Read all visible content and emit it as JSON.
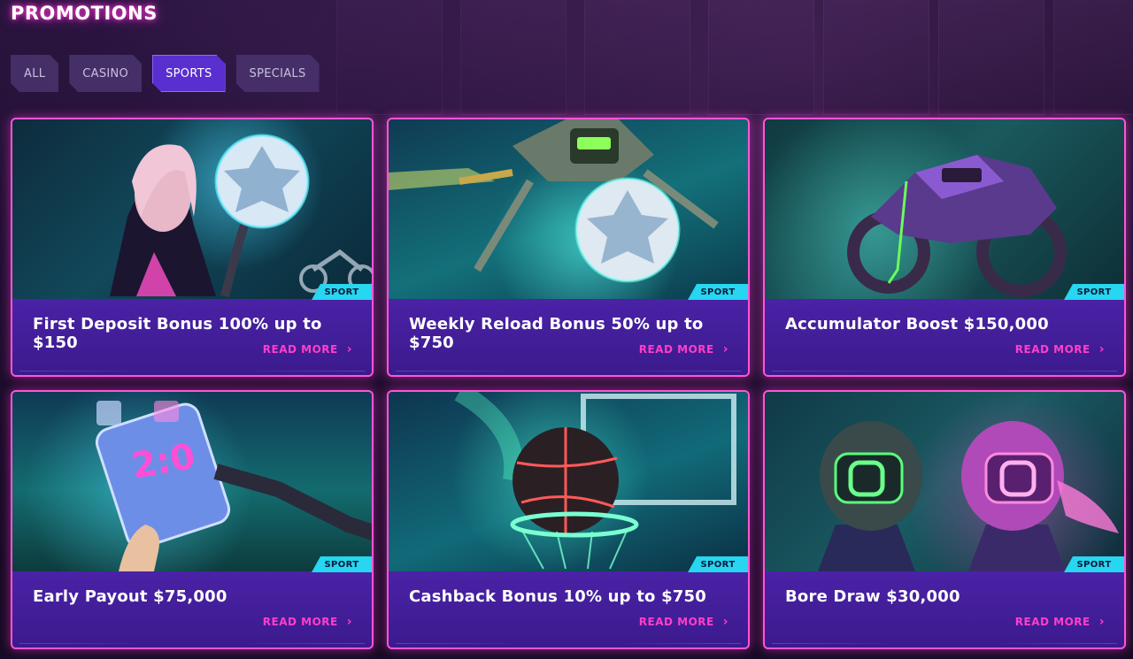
{
  "page": {
    "title": "PROMOTIONS"
  },
  "tabs": [
    {
      "label": "ALL",
      "active": false
    },
    {
      "label": "CASINO",
      "active": false
    },
    {
      "label": "SPORTS",
      "active": true
    },
    {
      "label": "SPECIALS",
      "active": false
    }
  ],
  "promos": [
    {
      "title": "First Deposit Bonus 100% up to $150",
      "badge": "SPORT",
      "read_more": "READ MORE",
      "art_icon": "soccer-ball-woman-icon"
    },
    {
      "title": "Weekly Reload Bonus 50% up to $750",
      "badge": "SPORT",
      "read_more": "READ MORE",
      "art_icon": "robot-soccer-ball-icon"
    },
    {
      "title": "Accumulator Boost $150,000",
      "badge": "SPORT",
      "read_more": "READ MORE",
      "art_icon": "motorcycle-icon"
    },
    {
      "title": "Early Payout $75,000",
      "badge": "SPORT",
      "read_more": "READ MORE",
      "art_icon": "phone-scoreboard-icon",
      "art_text": "2:0"
    },
    {
      "title": "Cashback Bonus 10% up to $750",
      "badge": "SPORT",
      "read_more": "READ MORE",
      "art_icon": "basketball-hoop-icon"
    },
    {
      "title": "Bore Draw $30,000",
      "badge": "SPORT",
      "read_more": "READ MORE",
      "art_icon": "helmets-icon"
    }
  ],
  "colors": {
    "accent_pink": "#ff3fc9",
    "badge_cyan": "#27d6f0",
    "card_footer": "#4a22a6",
    "tab_active": "#5a2fd0"
  }
}
